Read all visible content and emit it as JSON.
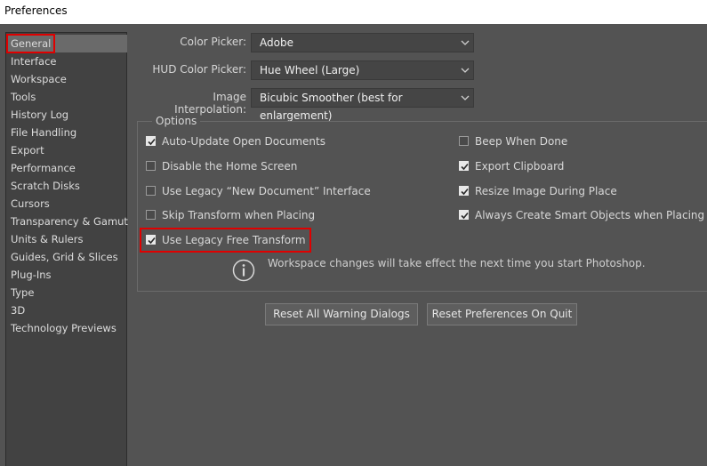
{
  "window": {
    "title": "Preferences"
  },
  "sidebar": {
    "items": [
      {
        "label": "General",
        "selected": true
      },
      {
        "label": "Interface"
      },
      {
        "label": "Workspace"
      },
      {
        "label": "Tools"
      },
      {
        "label": "History Log"
      },
      {
        "label": "File Handling"
      },
      {
        "label": "Export"
      },
      {
        "label": "Performance"
      },
      {
        "label": "Scratch Disks"
      },
      {
        "label": "Cursors"
      },
      {
        "label": "Transparency & Gamut"
      },
      {
        "label": "Units & Rulers"
      },
      {
        "label": "Guides, Grid & Slices"
      },
      {
        "label": "Plug-Ins"
      },
      {
        "label": "Type"
      },
      {
        "label": "3D"
      },
      {
        "label": "Technology Previews"
      }
    ]
  },
  "general": {
    "color_picker": {
      "label": "Color Picker:",
      "value": "Adobe"
    },
    "hud_color_picker": {
      "label": "HUD Color Picker:",
      "value": "Hue Wheel (Large)"
    },
    "image_interpolation": {
      "label": "Image Interpolation:",
      "value": "Bicubic Smoother (best for enlargement)"
    }
  },
  "options": {
    "legend": "Options",
    "left": [
      {
        "label": "Auto-Update Open Documents",
        "checked": true
      },
      {
        "label": "Disable the Home Screen",
        "checked": false
      },
      {
        "label": "Use Legacy “New Document” Interface",
        "checked": false
      },
      {
        "label": "Skip Transform when Placing",
        "checked": false
      },
      {
        "label": "Use Legacy Free Transform",
        "checked": true
      }
    ],
    "right": [
      {
        "label": "Beep When Done",
        "checked": false
      },
      {
        "label": "Export Clipboard",
        "checked": true
      },
      {
        "label": "Resize Image During Place",
        "checked": true
      },
      {
        "label": "Always Create Smart Objects when Placing",
        "checked": true
      }
    ],
    "info": "Workspace changes will take effect the next time you start Photoshop."
  },
  "buttons": {
    "reset_warnings": "Reset All Warning Dialogs",
    "reset_prefs": "Reset Preferences On Quit"
  },
  "colors": {
    "background": "#535353",
    "sidebar": "#424242",
    "selected": "#6a6a6a",
    "highlight": "#e00000"
  }
}
